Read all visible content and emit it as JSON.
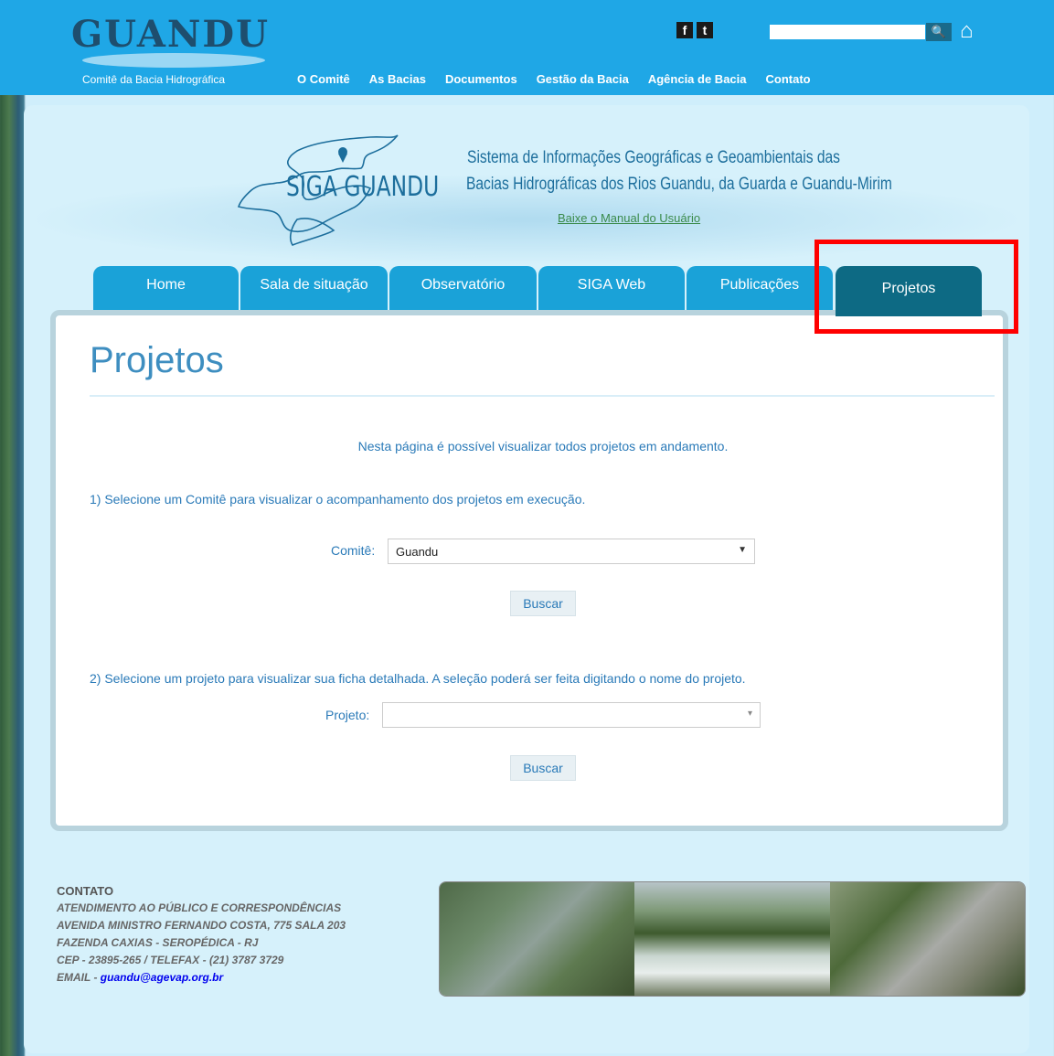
{
  "header": {
    "logo": "GUANDU",
    "tagline": "Comitê da Bacia Hidrográfica",
    "nav": [
      "O Comitê",
      "As Bacias",
      "Documentos",
      "Gestão da Bacia",
      "Agência de Bacia",
      "Contato"
    ],
    "social": [
      "f",
      "t"
    ],
    "search_placeholder": ""
  },
  "banner": {
    "siga_title": "SIGA GUANDU",
    "desc_line1": "Sistema de Informações Geográficas e Geoambientais das",
    "desc_line2": "Bacias Hidrográficas dos Rios Guandu, da Guarda e Guandu-Mirim",
    "manual_link": "Baixe o Manual do Usuário"
  },
  "tabs": [
    "Home",
    "Sala de situação",
    "Observatório",
    "SIGA Web",
    "Publicações",
    "Projetos"
  ],
  "active_tab": "Projetos",
  "content": {
    "title": "Projetos",
    "intro": "Nesta página é possível visualizar todos projetos em andamento.",
    "step1": "1) Selecione um Comitê para visualizar o acompanhamento dos projetos em execução.",
    "comite_label": "Comitê:",
    "comite_value": "Guandu",
    "buscar1": "Buscar",
    "step2": "2) Selecione um projeto para visualizar sua ficha detalhada. A seleção poderá ser feita digitando o nome do projeto.",
    "projeto_label": "Projeto:",
    "projeto_value": "",
    "buscar2": "Buscar"
  },
  "footer": {
    "heading": "CONTATO",
    "lines": [
      "ATENDIMENTO AO PÚBLICO E CORRESPONDÊNCIAS",
      "AVENIDA MINISTRO FERNANDO COSTA, 775 SALA 203",
      "FAZENDA CAXIAS - SEROPÉDICA - RJ",
      "CEP - 23895-265 / TELEFAX - (21) 3787 3729"
    ],
    "email_prefix": "EMAIL - ",
    "email": "guandu@agevap.org.br"
  },
  "colors": {
    "topbar": "#1fa7e6",
    "tab": "#1aa2d8",
    "tab_active": "#0d6a84",
    "highlight": "#ff0000"
  },
  "icons": [
    "facebook-icon",
    "twitter-icon",
    "search-icon",
    "home-icon",
    "map-pin-icon",
    "chevron-down-icon"
  ]
}
